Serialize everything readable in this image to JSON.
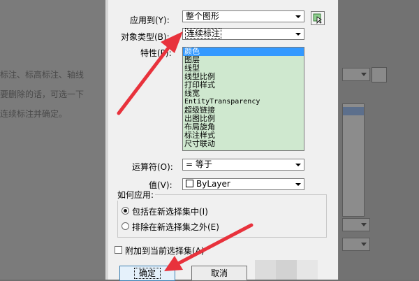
{
  "background_window": {
    "lines": [
      "标注、标高标注、轴线",
      "要删除的话，可选一下",
      "连续标注并确定。"
    ]
  },
  "dialog": {
    "apply_to": {
      "label": "应用到(Y):",
      "value": "整个图形"
    },
    "object_type": {
      "label": "对象类型(B):",
      "value": "连续标注"
    },
    "properties": {
      "label": "特性(P):",
      "items": [
        "颜色",
        "图层",
        "线型",
        "线型比例",
        "打印样式",
        "线宽",
        "EntityTransparency",
        "超级链接",
        "出图比例",
        "布局旋角",
        "标注样式",
        "尺寸联动"
      ],
      "selected_index": 0
    },
    "operator": {
      "label": "运算符(O):",
      "value": "= 等于"
    },
    "value": {
      "label": "值(V):",
      "value": "ByLayer"
    },
    "how_to_apply": {
      "title": "如何应用:",
      "options": [
        {
          "label": "包括在新选择集中(I)",
          "checked": true
        },
        {
          "label": "排除在新选择集之外(E)",
          "checked": false
        }
      ]
    },
    "append_checkbox": {
      "label": "附加到当前选择集(A)",
      "checked": false
    },
    "buttons": {
      "ok": "确定",
      "cancel": "取消"
    }
  },
  "colors": {
    "annotation_arrow": "#e8323c",
    "list_background": "#cfe8cf",
    "selection": "#3399ff"
  }
}
